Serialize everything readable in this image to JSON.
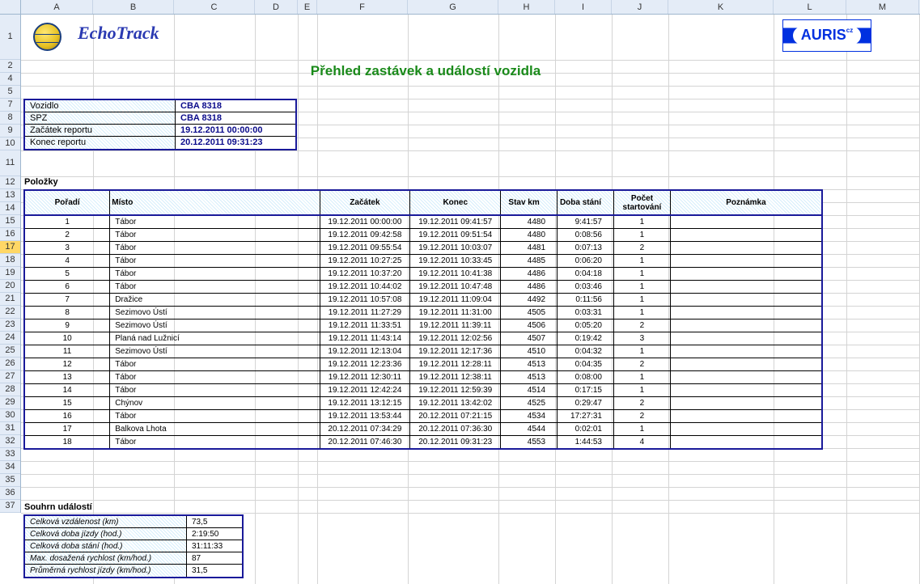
{
  "brand": "EchoTrack",
  "partner": "AURIS",
  "partner_suffix": "cz",
  "title": "Přehled zastávek a událostí vozidla",
  "columns": [
    "A",
    "B",
    "C",
    "D",
    "E",
    "F",
    "G",
    "H",
    "I",
    "J",
    "K",
    "L",
    "M"
  ],
  "row_numbers": [
    "1",
    "2",
    "4",
    "5",
    "7",
    "8",
    "9",
    "10",
    "11",
    "12",
    "13",
    "14",
    "15",
    "16",
    "17",
    "18",
    "19",
    "20",
    "21",
    "22",
    "23",
    "24",
    "25",
    "26",
    "27",
    "28",
    "29",
    "30",
    "31",
    "32",
    "33",
    "34",
    "35",
    "36",
    "37"
  ],
  "selected_row": "17",
  "info": {
    "rows": [
      {
        "label": "Vozidlo",
        "value": "CBA 8318"
      },
      {
        "label": "SPZ",
        "value": "CBA 8318"
      },
      {
        "label": "Začátek reportu",
        "value": "19.12.2011 00:00:00"
      },
      {
        "label": "Konec reportu",
        "value": "20.12.2011 09:31:23"
      }
    ]
  },
  "section_items": "Položky",
  "headers": {
    "order": "Pořadí",
    "place": "Místo",
    "start": "Začátek",
    "end": "Konec",
    "km": "Stav km",
    "dur": "Doba stání",
    "starts": "Počet startování",
    "note": "Poznámka"
  },
  "rows": [
    {
      "n": "1",
      "place": "Tábor",
      "s": "19.12.2011 00:00:00",
      "e": "19.12.2011 09:41:57",
      "km": "4480",
      "d": "9:41:57",
      "st": "1"
    },
    {
      "n": "2",
      "place": "Tábor",
      "s": "19.12.2011 09:42:58",
      "e": "19.12.2011 09:51:54",
      "km": "4480",
      "d": "0:08:56",
      "st": "1"
    },
    {
      "n": "3",
      "place": "Tábor",
      "s": "19.12.2011 09:55:54",
      "e": "19.12.2011 10:03:07",
      "km": "4481",
      "d": "0:07:13",
      "st": "2"
    },
    {
      "n": "4",
      "place": "Tábor",
      "s": "19.12.2011 10:27:25",
      "e": "19.12.2011 10:33:45",
      "km": "4485",
      "d": "0:06:20",
      "st": "1"
    },
    {
      "n": "5",
      "place": "Tábor",
      "s": "19.12.2011 10:37:20",
      "e": "19.12.2011 10:41:38",
      "km": "4486",
      "d": "0:04:18",
      "st": "1"
    },
    {
      "n": "6",
      "place": "Tábor",
      "s": "19.12.2011 10:44:02",
      "e": "19.12.2011 10:47:48",
      "km": "4486",
      "d": "0:03:46",
      "st": "1"
    },
    {
      "n": "7",
      "place": "Dražice",
      "s": "19.12.2011 10:57:08",
      "e": "19.12.2011 11:09:04",
      "km": "4492",
      "d": "0:11:56",
      "st": "1"
    },
    {
      "n": "8",
      "place": "Sezimovo Ústí",
      "s": "19.12.2011 11:27:29",
      "e": "19.12.2011 11:31:00",
      "km": "4505",
      "d": "0:03:31",
      "st": "1"
    },
    {
      "n": "9",
      "place": "Sezimovo Ústí",
      "s": "19.12.2011 11:33:51",
      "e": "19.12.2011 11:39:11",
      "km": "4506",
      "d": "0:05:20",
      "st": "2"
    },
    {
      "n": "10",
      "place": "Planá nad Lužnicí",
      "s": "19.12.2011 11:43:14",
      "e": "19.12.2011 12:02:56",
      "km": "4507",
      "d": "0:19:42",
      "st": "3"
    },
    {
      "n": "11",
      "place": "Sezimovo Ústí",
      "s": "19.12.2011 12:13:04",
      "e": "19.12.2011 12:17:36",
      "km": "4510",
      "d": "0:04:32",
      "st": "1"
    },
    {
      "n": "12",
      "place": "Tábor",
      "s": "19.12.2011 12:23:36",
      "e": "19.12.2011 12:28:11",
      "km": "4513",
      "d": "0:04:35",
      "st": "2"
    },
    {
      "n": "13",
      "place": "Tábor",
      "s": "19.12.2011 12:30:11",
      "e": "19.12.2011 12:38:11",
      "km": "4513",
      "d": "0:08:00",
      "st": "1"
    },
    {
      "n": "14",
      "place": "Tábor",
      "s": "19.12.2011 12:42:24",
      "e": "19.12.2011 12:59:39",
      "km": "4514",
      "d": "0:17:15",
      "st": "1"
    },
    {
      "n": "15",
      "place": "Chýnov",
      "s": "19.12.2011 13:12:15",
      "e": "19.12.2011 13:42:02",
      "km": "4525",
      "d": "0:29:47",
      "st": "2"
    },
    {
      "n": "16",
      "place": "Tábor",
      "s": "19.12.2011 13:53:44",
      "e": "20.12.2011 07:21:15",
      "km": "4534",
      "d": "17:27:31",
      "st": "2"
    },
    {
      "n": "17",
      "place": "Balkova Lhota",
      "s": "20.12.2011 07:34:29",
      "e": "20.12.2011 07:36:30",
      "km": "4544",
      "d": "0:02:01",
      "st": "1"
    },
    {
      "n": "18",
      "place": "Tábor",
      "s": "20.12.2011 07:46:30",
      "e": "20.12.2011 09:31:23",
      "km": "4553",
      "d": "1:44:53",
      "st": "4"
    }
  ],
  "section_summary": "Souhrn událostí",
  "summary": [
    {
      "label": "Celková vzdálenost (km)",
      "value": "73,5"
    },
    {
      "label": "Celková doba jízdy (hod.)",
      "value": "2:19:50"
    },
    {
      "label": "Celková doba stání (hod.)",
      "value": "31:11:33"
    },
    {
      "label": "Max. dosažená rychlost (km/hod.)",
      "value": "87"
    },
    {
      "label": "Průměrná rychlost jízdy (km/hod.)",
      "value": "31,5"
    }
  ]
}
